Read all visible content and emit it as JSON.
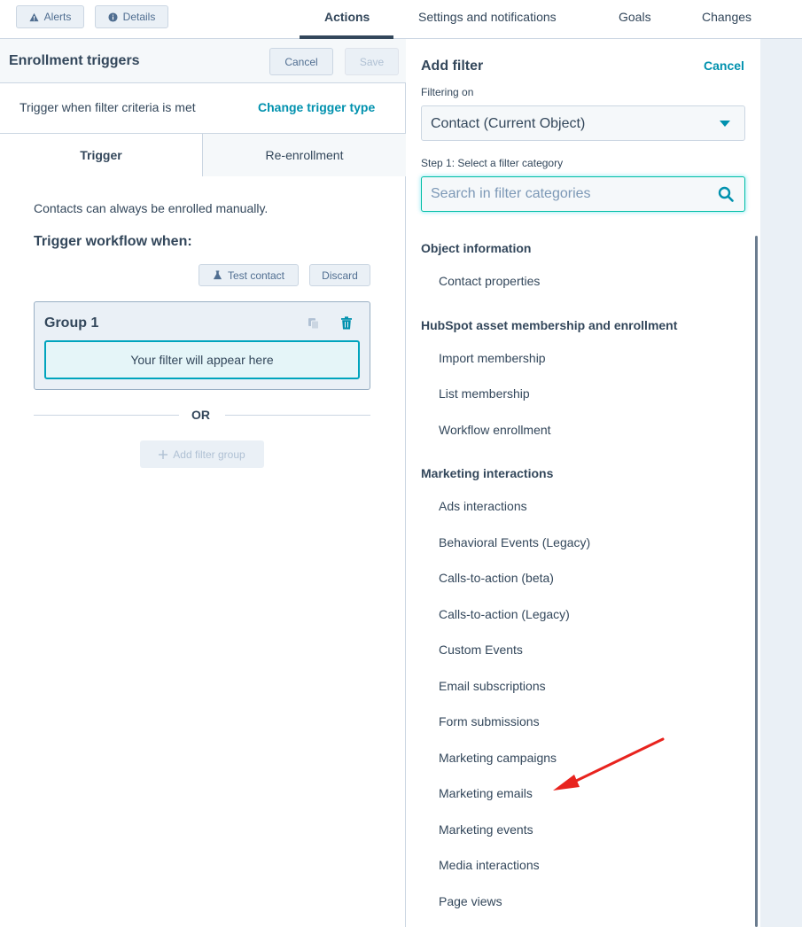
{
  "topbar": {
    "alerts_label": "Alerts",
    "details_label": "Details",
    "tabs": [
      {
        "label": "Actions",
        "active": true
      },
      {
        "label": "Settings and notifications",
        "active": false
      },
      {
        "label": "Goals",
        "active": false
      },
      {
        "label": "Changes",
        "active": false
      }
    ]
  },
  "left_panel": {
    "title": "Enrollment triggers",
    "cancel_label": "Cancel",
    "save_label": "Save",
    "trigger_text": "Trigger when filter criteria is met",
    "change_trigger_label": "Change trigger type",
    "tabs": [
      {
        "label": "Trigger",
        "active": true
      },
      {
        "label": "Re-enrollment",
        "active": false
      }
    ],
    "manual_note": "Contacts can always be enrolled manually.",
    "trigger_when": "Trigger workflow when:",
    "test_contact_label": "Test contact",
    "discard_label": "Discard",
    "group": {
      "title": "Group 1",
      "placeholder": "Your filter will appear here"
    },
    "or_label": "OR",
    "add_filter_group_label": "Add filter group"
  },
  "right_panel": {
    "title": "Add filter",
    "cancel_label": "Cancel",
    "filtering_on_label": "Filtering on",
    "filtering_on_value": "Contact (Current Object)",
    "step_label": "Step 1: Select a filter category",
    "search_placeholder": "Search in filter categories",
    "sections": [
      {
        "heading": "Object information",
        "items": [
          "Contact properties"
        ]
      },
      {
        "heading": "HubSpot asset membership and enrollment",
        "items": [
          "Import membership",
          "List membership",
          "Workflow enrollment"
        ]
      },
      {
        "heading": "Marketing interactions",
        "items": [
          "Ads interactions",
          "Behavioral Events (Legacy)",
          "Calls-to-action (beta)",
          "Calls-to-action (Legacy)",
          "Custom Events",
          "Email subscriptions",
          "Form submissions",
          "Marketing campaigns",
          "Marketing emails",
          "Marketing events",
          "Media interactions",
          "Page views"
        ]
      }
    ]
  },
  "colors": {
    "accent_teal": "#0091ae",
    "text_dark": "#33475b",
    "panel_bg": "#f5f8fa",
    "annotation_red": "#e8231e"
  }
}
